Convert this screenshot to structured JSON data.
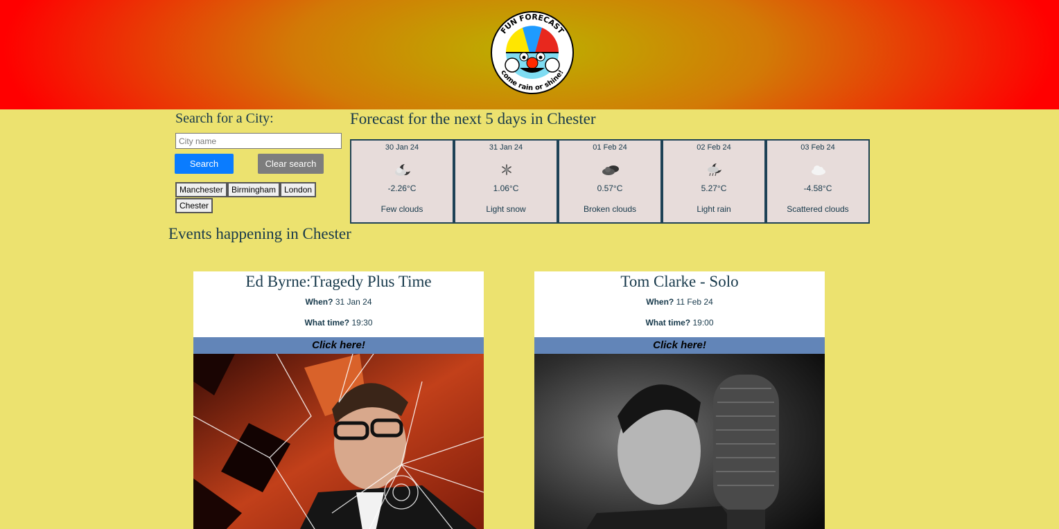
{
  "logo": {
    "text_top": "FUN FORECAST",
    "text_bottom": "come rain or shine!"
  },
  "search": {
    "heading": "Search for a City:",
    "placeholder": "City name",
    "search_label": "Search",
    "clear_label": "Clear search",
    "history": [
      "Manchester",
      "Birmingham",
      "London",
      "Chester"
    ]
  },
  "forecast": {
    "heading": "Forecast for the next 5 days in Chester",
    "days": [
      {
        "date": "30 Jan 24",
        "temp": "-2.26°C",
        "desc": "Few clouds",
        "icon": "few-clouds-night-icon"
      },
      {
        "date": "31 Jan 24",
        "temp": "1.06°C",
        "desc": "Light snow",
        "icon": "snowflake-icon"
      },
      {
        "date": "01 Feb 24",
        "temp": "0.57°C",
        "desc": "Broken clouds",
        "icon": "broken-clouds-icon"
      },
      {
        "date": "02 Feb 24",
        "temp": "5.27°C",
        "desc": "Light rain",
        "icon": "rain-icon"
      },
      {
        "date": "03 Feb 24",
        "temp": "-4.58°C",
        "desc": "Scattered clouds",
        "icon": "scattered-clouds-icon"
      }
    ]
  },
  "events": {
    "heading": "Events happening in Chester",
    "items": [
      {
        "title": "Ed Byrne:Tragedy Plus Time",
        "when_label": "When?",
        "when": "31 Jan 24",
        "time_label": "What time?",
        "time": "19:30",
        "link_label": "Click here!"
      },
      {
        "title": "Tom Clarke - Solo",
        "when_label": "When?",
        "when": "11 Feb 24",
        "time_label": "What time?",
        "time": "19:00",
        "link_label": "Click here!"
      }
    ]
  },
  "colors": {
    "background": "#ece26f",
    "text": "#16384a",
    "search_button": "#0a7cff",
    "clear_button": "#7d7d7d",
    "click_bar": "#6285b8",
    "day_bg": "#e7dcda"
  }
}
